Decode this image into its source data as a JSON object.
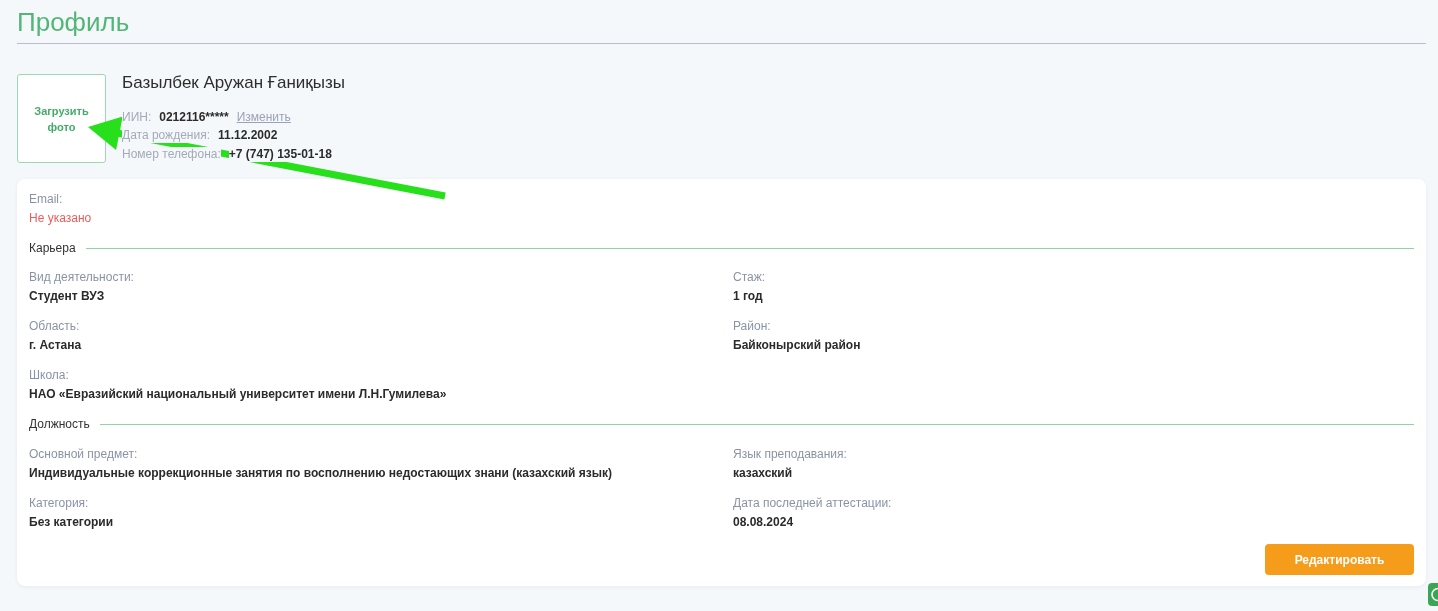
{
  "page": {
    "title": "Профиль"
  },
  "profile": {
    "photo_button": "Загрузить фото",
    "name": "Базылбек Аружан Ғаниқызы",
    "details": [
      {
        "label": "ИИН:",
        "value": "0212116*****",
        "action": "Изменить"
      },
      {
        "label": "Дата рождения:",
        "value": "11.12.2002"
      },
      {
        "label": "Номер телефона:",
        "value": "+7 (747) 135-01-18"
      }
    ]
  },
  "contact": {
    "label": "Email:",
    "value": "Не указано",
    "missing": true
  },
  "sections": [
    {
      "title": "Карьера",
      "fields": [
        {
          "label": "Вид деятельности:",
          "value": "Студент ВУЗ"
        },
        {
          "label": "Стаж:",
          "value": "1 год"
        },
        {
          "label": "Область:",
          "value": "г. Астана"
        },
        {
          "label": "Район:",
          "value": "Байконырский район"
        },
        {
          "label": "Школа:",
          "value": "НАО «Евразийский национальный университет имени Л.Н.Гумилева»"
        }
      ]
    },
    {
      "title": "Должность",
      "fields": [
        {
          "label": "Основной предмет:",
          "value": "Индивидуальные коррекционные занятия по восполнению недостающих знани (казахский язык)"
        },
        {
          "label": "Язык преподавания:",
          "value": "казахский"
        },
        {
          "label": "Категория:",
          "value": "Без категории"
        },
        {
          "label": "Дата последней аттестации:",
          "value": "08.08.2024"
        }
      ]
    }
  ],
  "edit_button": "Редактировать",
  "annotations": [
    {
      "kind": "arrow"
    }
  ]
}
